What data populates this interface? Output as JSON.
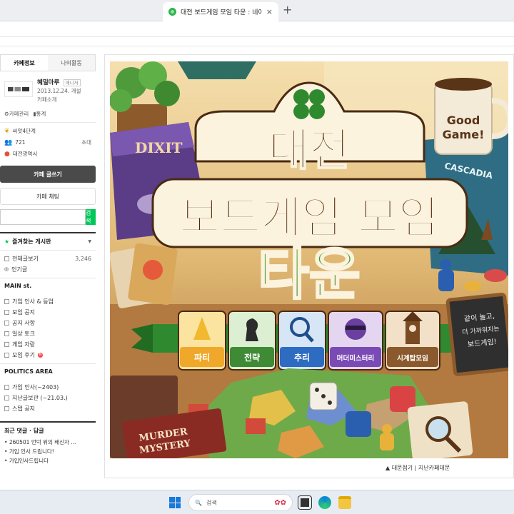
{
  "browser": {
    "tab_title": "대전 보드게임 모임 타운 : 네이버",
    "close_icon": "×",
    "new_tab_icon": "+"
  },
  "sidebar": {
    "tabs": [
      "카페정보",
      "나의활동"
    ],
    "profile": {
      "name": "혜밀마루",
      "role": "매니저",
      "since": "2013.12.24. 개설",
      "intro_link": "카페소개"
    },
    "links": [
      "카페관리",
      "통계"
    ],
    "stats": {
      "level": "씨앗4단계",
      "members": "721",
      "invite": "초대",
      "region": "대전광역시"
    },
    "write_button": "카페 글쓰기",
    "chat_button": "카페 채팅",
    "search_button": "검색",
    "favorites_title": "즐겨찾는 게시판",
    "top_menu": [
      {
        "label": "전체글보기",
        "count": "3,246"
      },
      {
        "label": "인기글",
        "count": ""
      }
    ],
    "section_main": "MAIN st.",
    "main_menu": [
      "가입 인사 & 등업",
      "모임 공지",
      "공지 사항",
      "일상 토크",
      "게임 자랑",
      "모임 후기"
    ],
    "new_badge": "N",
    "section_politics": "POLITICS AREA",
    "politics_menu": [
      "가입 인사(~2403)",
      "지난글보관 (~21.03.)",
      "스탭 공지"
    ],
    "recent_title": "최근 댓글 · 답글",
    "recent_items": [
      "260501 언덕 위의 배신자 ...",
      "가입 인사 드립니다!",
      "가입인사드립니다"
    ]
  },
  "banner": {
    "title_line1": "대전",
    "title_line2": "보드게임 모임",
    "title_line3": "타운",
    "mug_text_1": "Good",
    "mug_text_2": "Game!",
    "box_dixit": "DIXIT",
    "box_cascadia": "CASCADIA",
    "murder_1": "MURDER",
    "murder_2": "MYSTERY",
    "board_lines": [
      "같이 놀고,",
      "더 가까워지는",
      "보드게임!"
    ],
    "categories": [
      "파티",
      "전략",
      "추리",
      "머더미스터리",
      "시계탑모임"
    ],
    "footer": "▲ 대문접기 | 지난카페대문"
  },
  "taskbar": {
    "search_label": "검색"
  },
  "colors": {
    "naver_green": "#03c75a",
    "title_brown": "#5a2e12",
    "title_green": "#2f8a2f"
  }
}
